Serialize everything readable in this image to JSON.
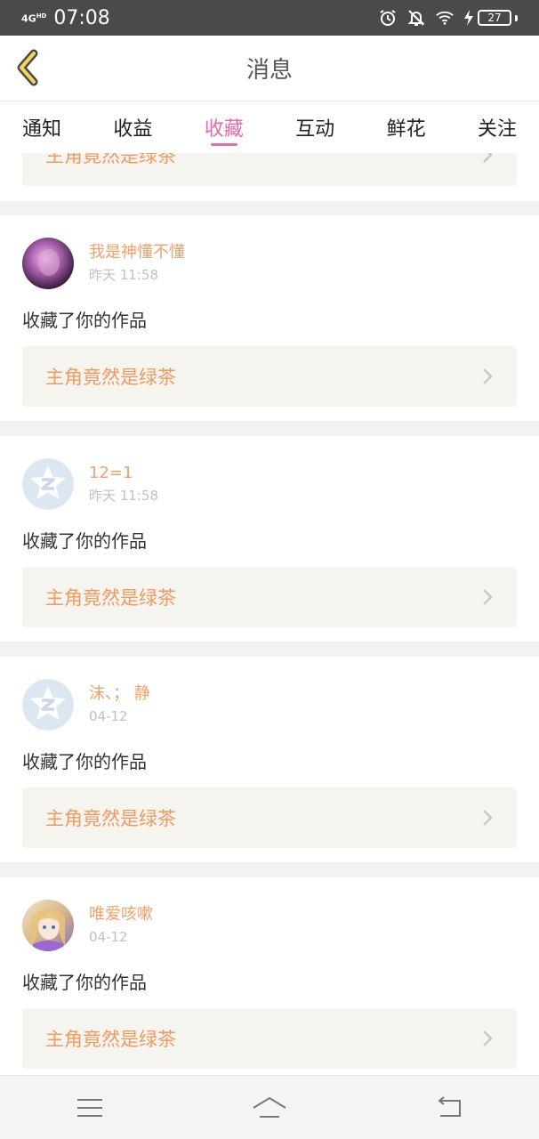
{
  "status_bar": {
    "network": "4G",
    "network_sup": "HD",
    "time": "07:08",
    "battery": "27",
    "icons": [
      "alarm-icon",
      "bell-off-icon",
      "wifi-icon",
      "charging-icon"
    ]
  },
  "header": {
    "title": "消息",
    "back_icon": "chevron-left-icon"
  },
  "tabs": [
    {
      "label": "通知",
      "active": false
    },
    {
      "label": "收益",
      "active": false
    },
    {
      "label": "收藏",
      "active": true
    },
    {
      "label": "互动",
      "active": false
    },
    {
      "label": "鲜花",
      "active": false
    },
    {
      "label": "关注",
      "active": false
    }
  ],
  "colors": {
    "accent": "#e86aa6",
    "username": "#f0a06a",
    "work_title": "#ef9a62",
    "link_bg": "#f5f4ee"
  },
  "partial_item": {
    "work_title": "主角竟然是绿茶"
  },
  "messages": [
    {
      "user": "我是神懂不懂",
      "time": "昨天 11:58",
      "action": "收藏了你的作品",
      "work_title": "主角竟然是绿茶",
      "avatar": "photo-avatar"
    },
    {
      "user": "12=1",
      "time": "昨天 11:58",
      "action": "收藏了你的作品",
      "work_title": "主角竟然是绿茶",
      "avatar": "default-avatar"
    },
    {
      "user": "沫、；  静",
      "time": "04-12",
      "action": "收藏了你的作品",
      "work_title": "主角竟然是绿茶",
      "avatar": "default-avatar"
    },
    {
      "user": "唯爱咳嗽",
      "time": "04-12",
      "action": "收藏了你的作品",
      "work_title": "主角竟然是绿茶",
      "avatar": "anime-avatar"
    }
  ],
  "nav_bar": {
    "icons": [
      "menu-icon",
      "home-icon",
      "back-icon"
    ]
  }
}
